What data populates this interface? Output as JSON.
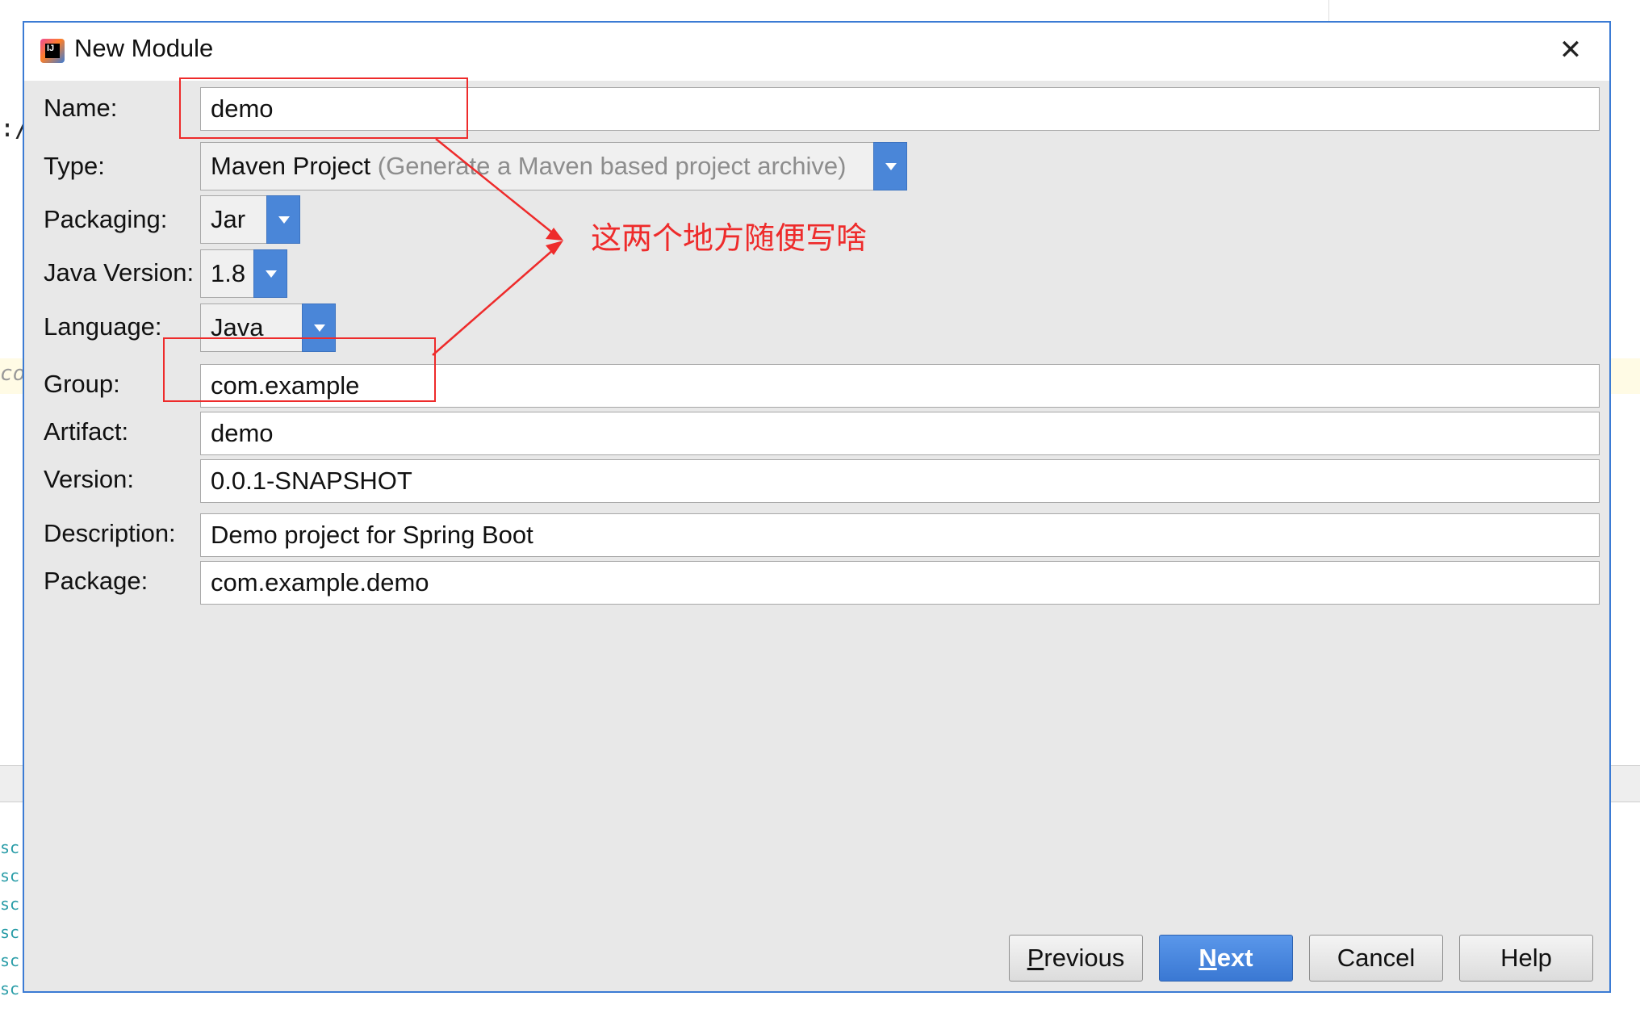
{
  "window": {
    "title": "New Module",
    "icon": "intellij-idea-icon",
    "close_icon": "close-icon"
  },
  "form": {
    "name": {
      "label": "Name:",
      "value": "demo"
    },
    "type": {
      "label": "Type:",
      "value": "Maven Project",
      "hint": "(Generate a Maven based project archive)"
    },
    "packaging": {
      "label": "Packaging:",
      "value": "Jar"
    },
    "java_version": {
      "label": "Java Version:",
      "value": "1.8"
    },
    "language": {
      "label": "Language:",
      "value": "Java"
    },
    "group": {
      "label": "Group:",
      "value": "com.example"
    },
    "artifact": {
      "label": "Artifact:",
      "value": "demo"
    },
    "version": {
      "label": "Version:",
      "value": "0.0.1-SNAPSHOT"
    },
    "description": {
      "label": "Description:",
      "value": "Demo project for Spring Boot"
    },
    "package": {
      "label": "Package:",
      "value": "com.example.demo"
    }
  },
  "buttons": {
    "previous_mnemonic": "P",
    "previous_rest": "revious",
    "next_mnemonic": "N",
    "next_rest": "ext",
    "cancel": "Cancel",
    "help": "Help"
  },
  "annotation": {
    "text": "这两个地方随便写啥",
    "color": "#ee2b2b"
  },
  "colors": {
    "accent": "#3b7bd4",
    "dialog_bg": "#e8e8e8"
  }
}
